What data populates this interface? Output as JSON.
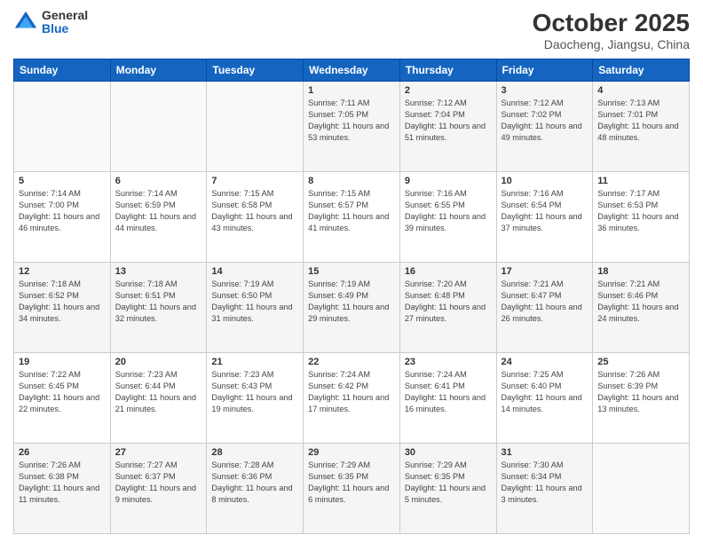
{
  "header": {
    "logo_general": "General",
    "logo_blue": "Blue",
    "month": "October 2025",
    "location": "Daocheng, Jiangsu, China"
  },
  "weekdays": [
    "Sunday",
    "Monday",
    "Tuesday",
    "Wednesday",
    "Thursday",
    "Friday",
    "Saturday"
  ],
  "weeks": [
    [
      {
        "num": "",
        "info": ""
      },
      {
        "num": "",
        "info": ""
      },
      {
        "num": "",
        "info": ""
      },
      {
        "num": "1",
        "info": "Sunrise: 7:11 AM\nSunset: 7:05 PM\nDaylight: 11 hours and 53 minutes."
      },
      {
        "num": "2",
        "info": "Sunrise: 7:12 AM\nSunset: 7:04 PM\nDaylight: 11 hours and 51 minutes."
      },
      {
        "num": "3",
        "info": "Sunrise: 7:12 AM\nSunset: 7:02 PM\nDaylight: 11 hours and 49 minutes."
      },
      {
        "num": "4",
        "info": "Sunrise: 7:13 AM\nSunset: 7:01 PM\nDaylight: 11 hours and 48 minutes."
      }
    ],
    [
      {
        "num": "5",
        "info": "Sunrise: 7:14 AM\nSunset: 7:00 PM\nDaylight: 11 hours and 46 minutes."
      },
      {
        "num": "6",
        "info": "Sunrise: 7:14 AM\nSunset: 6:59 PM\nDaylight: 11 hours and 44 minutes."
      },
      {
        "num": "7",
        "info": "Sunrise: 7:15 AM\nSunset: 6:58 PM\nDaylight: 11 hours and 43 minutes."
      },
      {
        "num": "8",
        "info": "Sunrise: 7:15 AM\nSunset: 6:57 PM\nDaylight: 11 hours and 41 minutes."
      },
      {
        "num": "9",
        "info": "Sunrise: 7:16 AM\nSunset: 6:55 PM\nDaylight: 11 hours and 39 minutes."
      },
      {
        "num": "10",
        "info": "Sunrise: 7:16 AM\nSunset: 6:54 PM\nDaylight: 11 hours and 37 minutes."
      },
      {
        "num": "11",
        "info": "Sunrise: 7:17 AM\nSunset: 6:53 PM\nDaylight: 11 hours and 36 minutes."
      }
    ],
    [
      {
        "num": "12",
        "info": "Sunrise: 7:18 AM\nSunset: 6:52 PM\nDaylight: 11 hours and 34 minutes."
      },
      {
        "num": "13",
        "info": "Sunrise: 7:18 AM\nSunset: 6:51 PM\nDaylight: 11 hours and 32 minutes."
      },
      {
        "num": "14",
        "info": "Sunrise: 7:19 AM\nSunset: 6:50 PM\nDaylight: 11 hours and 31 minutes."
      },
      {
        "num": "15",
        "info": "Sunrise: 7:19 AM\nSunset: 6:49 PM\nDaylight: 11 hours and 29 minutes."
      },
      {
        "num": "16",
        "info": "Sunrise: 7:20 AM\nSunset: 6:48 PM\nDaylight: 11 hours and 27 minutes."
      },
      {
        "num": "17",
        "info": "Sunrise: 7:21 AM\nSunset: 6:47 PM\nDaylight: 11 hours and 26 minutes."
      },
      {
        "num": "18",
        "info": "Sunrise: 7:21 AM\nSunset: 6:46 PM\nDaylight: 11 hours and 24 minutes."
      }
    ],
    [
      {
        "num": "19",
        "info": "Sunrise: 7:22 AM\nSunset: 6:45 PM\nDaylight: 11 hours and 22 minutes."
      },
      {
        "num": "20",
        "info": "Sunrise: 7:23 AM\nSunset: 6:44 PM\nDaylight: 11 hours and 21 minutes."
      },
      {
        "num": "21",
        "info": "Sunrise: 7:23 AM\nSunset: 6:43 PM\nDaylight: 11 hours and 19 minutes."
      },
      {
        "num": "22",
        "info": "Sunrise: 7:24 AM\nSunset: 6:42 PM\nDaylight: 11 hours and 17 minutes."
      },
      {
        "num": "23",
        "info": "Sunrise: 7:24 AM\nSunset: 6:41 PM\nDaylight: 11 hours and 16 minutes."
      },
      {
        "num": "24",
        "info": "Sunrise: 7:25 AM\nSunset: 6:40 PM\nDaylight: 11 hours and 14 minutes."
      },
      {
        "num": "25",
        "info": "Sunrise: 7:26 AM\nSunset: 6:39 PM\nDaylight: 11 hours and 13 minutes."
      }
    ],
    [
      {
        "num": "26",
        "info": "Sunrise: 7:26 AM\nSunset: 6:38 PM\nDaylight: 11 hours and 11 minutes."
      },
      {
        "num": "27",
        "info": "Sunrise: 7:27 AM\nSunset: 6:37 PM\nDaylight: 11 hours and 9 minutes."
      },
      {
        "num": "28",
        "info": "Sunrise: 7:28 AM\nSunset: 6:36 PM\nDaylight: 11 hours and 8 minutes."
      },
      {
        "num": "29",
        "info": "Sunrise: 7:29 AM\nSunset: 6:35 PM\nDaylight: 11 hours and 6 minutes."
      },
      {
        "num": "30",
        "info": "Sunrise: 7:29 AM\nSunset: 6:35 PM\nDaylight: 11 hours and 5 minutes."
      },
      {
        "num": "31",
        "info": "Sunrise: 7:30 AM\nSunset: 6:34 PM\nDaylight: 11 hours and 3 minutes."
      },
      {
        "num": "",
        "info": ""
      }
    ]
  ]
}
